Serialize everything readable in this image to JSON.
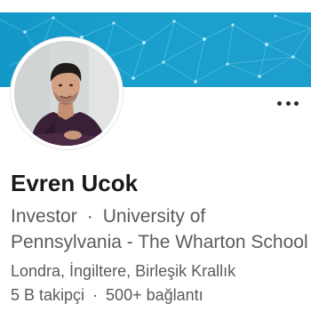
{
  "colors": {
    "banner": "#1a9fcd",
    "name_text": "#191919",
    "secondary_text": "#5b5b5b"
  },
  "profile": {
    "name": "Evren Ucok",
    "title": "Investor",
    "education": "University of Pennsylvania - The Wharton School",
    "location": "Londra, İngiltere, Birleşik Krallık",
    "followers": "5 B takipçi",
    "connections": "500+ bağlantı",
    "separator": "·"
  },
  "icons": {
    "more": "more-horizontal-icon",
    "avatar": "profile-photo"
  }
}
